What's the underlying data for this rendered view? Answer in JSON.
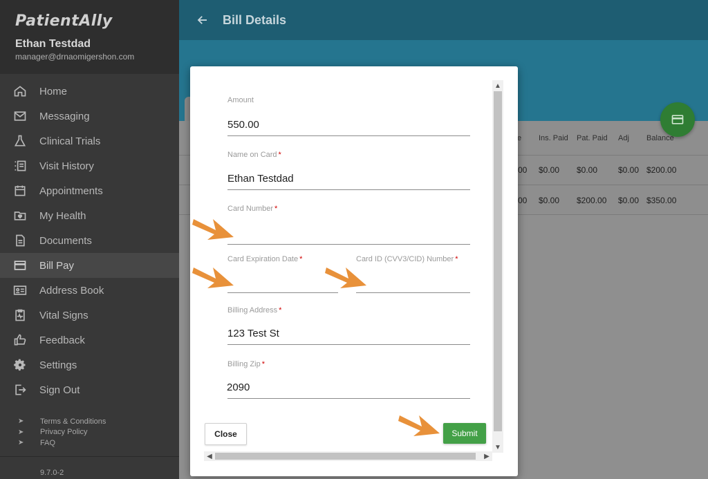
{
  "sidebar": {
    "logo": "PatientAlly",
    "user_name": "Ethan Testdad",
    "user_email": "manager@drnaomigershon.com",
    "items": [
      {
        "label": "Home",
        "icon": "home-icon"
      },
      {
        "label": "Messaging",
        "icon": "mail-icon"
      },
      {
        "label": "Clinical Trials",
        "icon": "flask-icon"
      },
      {
        "label": "Visit History",
        "icon": "list-icon"
      },
      {
        "label": "Appointments",
        "icon": "calendar-icon"
      },
      {
        "label": "My Health",
        "icon": "folder-heart-icon"
      },
      {
        "label": "Documents",
        "icon": "document-icon"
      },
      {
        "label": "Bill Pay",
        "icon": "credit-card-icon",
        "active": true
      },
      {
        "label": "Address Book",
        "icon": "contact-card-icon"
      },
      {
        "label": "Vital Signs",
        "icon": "clipboard-pulse-icon"
      },
      {
        "label": "Feedback",
        "icon": "thumb-up-icon"
      },
      {
        "label": "Settings",
        "icon": "gear-icon"
      },
      {
        "label": "Sign Out",
        "icon": "sign-out-icon"
      }
    ],
    "footer_links": [
      {
        "label": "Terms & Conditions"
      },
      {
        "label": "Privacy Policy"
      },
      {
        "label": "FAQ"
      }
    ],
    "version": "9.7.0-2"
  },
  "appbar": {
    "title": "Bill Details"
  },
  "table": {
    "headers": [
      "e",
      "Ins. Paid",
      "Pat. Paid",
      "Adj",
      "Balance"
    ],
    "rows": [
      [
        "00",
        "$0.00",
        "$0.00",
        "$0.00",
        "$200.00"
      ],
      [
        "00",
        "$0.00",
        "$200.00",
        "$0.00",
        "$350.00"
      ]
    ]
  },
  "modal": {
    "amount": {
      "label": "Amount",
      "value": "550.00"
    },
    "name_on_card": {
      "label": "Name on Card",
      "required": "*",
      "value": "Ethan Testdad"
    },
    "card_number": {
      "label": "Card Number",
      "required": "*",
      "value": ""
    },
    "expiration": {
      "label": "Card Expiration Date",
      "required": "*",
      "value": ""
    },
    "cvv": {
      "label": "Card ID (CVV3/CID) Number",
      "required": "*",
      "value": ""
    },
    "billing_address": {
      "label": "Billing Address",
      "required": "*",
      "value": "123 Test St"
    },
    "billing_zip": {
      "label": "Billing Zip",
      "required": "*",
      "value": "2090"
    },
    "close_label": "Close",
    "submit_label": "Submit"
  },
  "colors": {
    "appbar": "#1e5d72",
    "banner": "#25758f",
    "sidebar": "#383838",
    "submit": "#43a047",
    "fab": "#2f7d33",
    "annotation_arrow": "#e8913a",
    "required_mark": "#d00000"
  }
}
